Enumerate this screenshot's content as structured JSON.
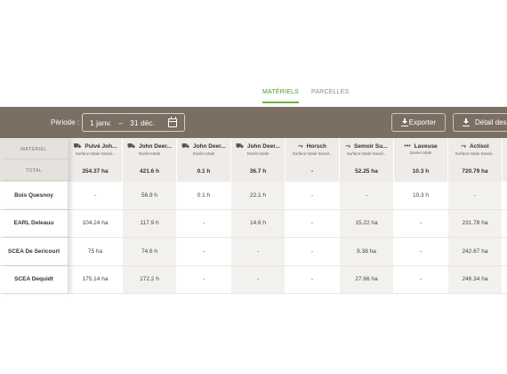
{
  "tabs": [
    {
      "label": "MATÉRIELS",
      "active": true
    },
    {
      "label": "PARCELLES",
      "active": false
    }
  ],
  "toolbar": {
    "period_label": "Période :",
    "date_start": "1 janv.",
    "date_sep": "–",
    "date_end": "31 déc.",
    "export_label": "Exporter",
    "detail_label": "Détail des i"
  },
  "table": {
    "header_label": "MATÉRIEL",
    "total_label": "TOTAL",
    "machines": [
      {
        "name": "Pulvé Joh...",
        "sub": "Surface totale travail...",
        "icon": "tractor-icon",
        "total": "354.37 ha"
      },
      {
        "name": "John Deer...",
        "sub": "Durée totale",
        "icon": "tractor-icon",
        "total": "421.6 h"
      },
      {
        "name": "John Deer...",
        "sub": "Durée totale",
        "icon": "tractor-icon",
        "total": "0.1 h"
      },
      {
        "name": "John Deer...",
        "sub": "Durée totale",
        "icon": "tractor-icon",
        "total": "36.7 h"
      },
      {
        "name": "Horsch",
        "sub": "Surface totale travail...",
        "icon": "seeder-icon",
        "total": "-"
      },
      {
        "name": "Semoir Su...",
        "sub": "Surface totale travail...",
        "icon": "seeder-icon",
        "total": "52.25 ha"
      },
      {
        "name": "Laveuse",
        "sub": "Durée totale",
        "icon": "dots-icon",
        "total": "10.3 h"
      },
      {
        "name": "Actisol",
        "sub": "Surface totale travail...",
        "icon": "seeder-icon",
        "total": "720.79 ha"
      }
    ],
    "rows": [
      {
        "org": "Bois Quesnoy",
        "values": [
          "-",
          "56.9 h",
          "0.1 h",
          "22.1 h",
          "-",
          "-",
          "10.3 h",
          "-"
        ]
      },
      {
        "org": "EARL Deleauu",
        "values": [
          "104.24 ha",
          "117.9 h",
          "-",
          "14.6 h",
          "-",
          "15.22 ha",
          "-",
          "231.78 ha"
        ]
      },
      {
        "org": "SCEA De Sericourt",
        "values": [
          "75 ha",
          "74.6 h",
          "-",
          "-",
          "-",
          "9.38 ha",
          "-",
          "242.67 ha"
        ]
      },
      {
        "org": "SCEA Dequidt",
        "values": [
          "175.14 ha",
          "172.2 h",
          "-",
          "-",
          "-",
          "27.66 ha",
          "-",
          "246.34 ha"
        ]
      }
    ]
  }
}
